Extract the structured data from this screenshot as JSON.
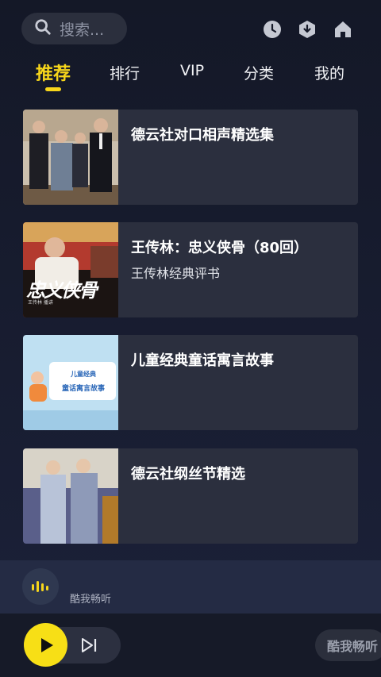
{
  "search": {
    "placeholder": "搜索..."
  },
  "header_icons": [
    "history-icon",
    "download-icon",
    "home-icon"
  ],
  "tabs": [
    {
      "label": "推荐",
      "active": true
    },
    {
      "label": "排行",
      "active": false
    },
    {
      "label": "VIP",
      "active": false
    },
    {
      "label": "分类",
      "active": false
    },
    {
      "label": "我的",
      "active": false
    }
  ],
  "items": [
    {
      "title": "德云社对口相声精选集",
      "subtitle": ""
    },
    {
      "title": "王传林：忠义侠骨（80回）",
      "subtitle": "王传林经典评书"
    },
    {
      "title": "儿童经典童话寓言故事",
      "subtitle": ""
    },
    {
      "title": "德云社纲丝节精选",
      "subtitle": ""
    }
  ],
  "thumb_text": {
    "item2_title_art": "忠义侠骨",
    "item2_small": "王传林 播讲",
    "item3_line1": "儿童经典",
    "item3_line2": "童话寓言故事"
  },
  "player": {
    "name": "酷我畅听",
    "brand": "酷我畅听"
  },
  "colors": {
    "accent": "#f7d61b",
    "background": "#161a2a",
    "card": "#2b2f3e",
    "mini_player": "#242b44"
  }
}
